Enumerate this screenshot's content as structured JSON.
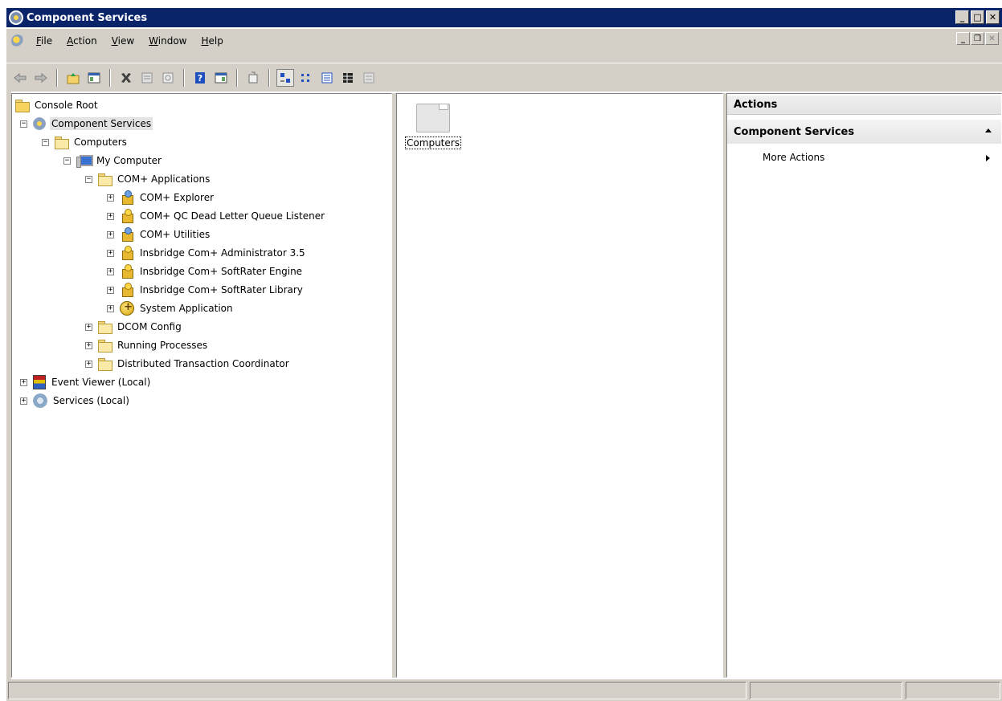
{
  "window": {
    "title": "Component Services"
  },
  "menu": {
    "items": [
      {
        "label": "File",
        "accel": "F",
        "rest": "ile"
      },
      {
        "label": "Action",
        "accel": "A",
        "rest": "ction"
      },
      {
        "label": "View",
        "accel": "V",
        "rest": "iew"
      },
      {
        "label": "Window",
        "accel": "W",
        "rest": "indow"
      },
      {
        "label": "Help",
        "accel": "H",
        "rest": "elp"
      }
    ]
  },
  "tree": {
    "nodes": [
      {
        "label": "Console Root"
      },
      {
        "label": "Component Services",
        "expander": "−"
      },
      {
        "label": "Computers",
        "expander": "−"
      },
      {
        "label": "My Computer",
        "expander": "−"
      },
      {
        "label": "COM+ Applications",
        "expander": "−"
      },
      {
        "label": "COM+ Explorer",
        "expander": "+"
      },
      {
        "label": "COM+ QC Dead Letter Queue Listener",
        "expander": "+"
      },
      {
        "label": "COM+ Utilities",
        "expander": "+"
      },
      {
        "label": "Insbridge Com+ Administrator 3.5",
        "expander": "+"
      },
      {
        "label": "Insbridge Com+ SoftRater Engine",
        "expander": "+"
      },
      {
        "label": "Insbridge Com+ SoftRater Library",
        "expander": "+"
      },
      {
        "label": "System Application",
        "expander": "+"
      },
      {
        "label": "DCOM Config",
        "expander": "+"
      },
      {
        "label": "Running Processes",
        "expander": "+"
      },
      {
        "label": "Distributed Transaction Coordinator",
        "expander": "+"
      },
      {
        "label": "Event Viewer (Local)",
        "expander": "+"
      },
      {
        "label": "Services (Local)",
        "expander": "+"
      }
    ]
  },
  "list": {
    "items": [
      {
        "label": "Computers"
      }
    ]
  },
  "actions": {
    "header": "Actions",
    "group": "Component Services",
    "items": [
      {
        "label": "More Actions"
      }
    ]
  }
}
